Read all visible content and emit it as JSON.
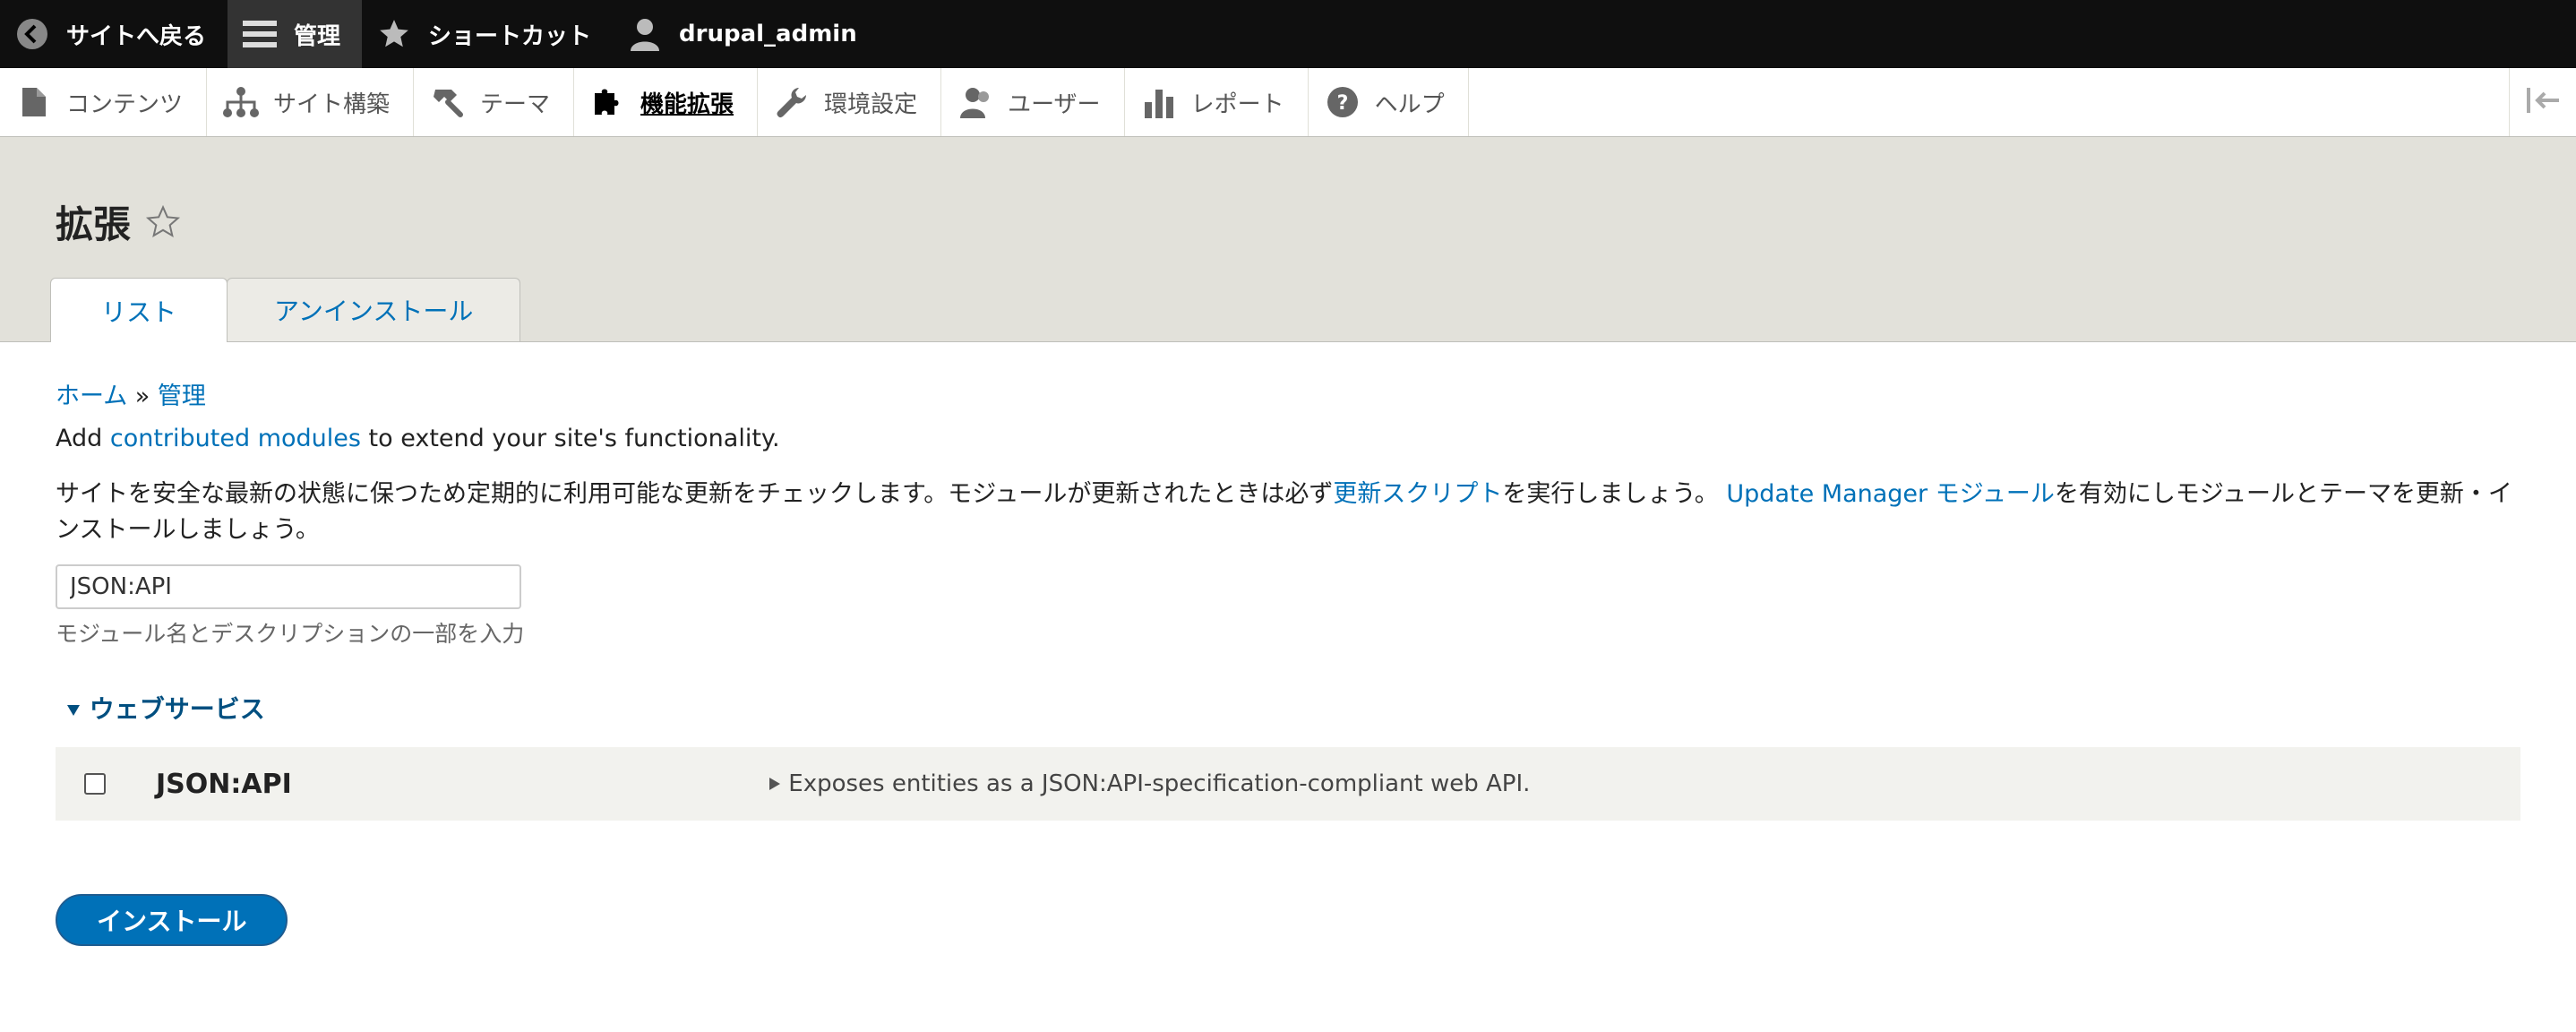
{
  "toolbar": {
    "back_label": "サイトへ戻る",
    "manage_label": "管理",
    "shortcuts_label": "ショートカット",
    "user_label": "drupal_admin"
  },
  "tray": {
    "items": [
      {
        "label": "コンテンツ",
        "icon": "file-icon"
      },
      {
        "label": "サイト構築",
        "icon": "sitemap-icon"
      },
      {
        "label": "テーマ",
        "icon": "paintbrush-icon"
      },
      {
        "label": "機能拡張",
        "icon": "puzzle-icon"
      },
      {
        "label": "環境設定",
        "icon": "wrench-icon"
      },
      {
        "label": "ユーザー",
        "icon": "people-icon"
      },
      {
        "label": "レポート",
        "icon": "bar-chart-icon"
      },
      {
        "label": "ヘルプ",
        "icon": "help-icon"
      }
    ]
  },
  "page": {
    "title": "拡張",
    "tabs": [
      "リスト",
      "アンインストール"
    ]
  },
  "breadcrumb": {
    "home": "ホーム",
    "separator": "»",
    "admin": "管理"
  },
  "intro": {
    "prefix": "Add ",
    "link": "contributed modules",
    "suffix": " to extend your site's functionality."
  },
  "help": {
    "part1": "サイトを安全な最新の状態に保つため定期的に利用可能な更新をチェックします。モジュールが更新されたときは必ず",
    "link1": "更新スクリプト",
    "part2": "を実行しましょう。",
    "link2": "Update Manager モジュール",
    "part3": "を有効にしモジュールとテーマを更新・インストールしましょう。"
  },
  "filter": {
    "value": "JSON:API",
    "description": "モジュール名とデスクリプションの一部を入力"
  },
  "group": {
    "title": "ウェブサービス"
  },
  "module": {
    "name": "JSON:API",
    "description": "Exposes entities as a JSON:API-specification-compliant web API."
  },
  "install_label": "インストール",
  "colors": {
    "link": "#0071b8",
    "toolbar": "#0f0f0f",
    "header_bg": "#e2e1da"
  }
}
